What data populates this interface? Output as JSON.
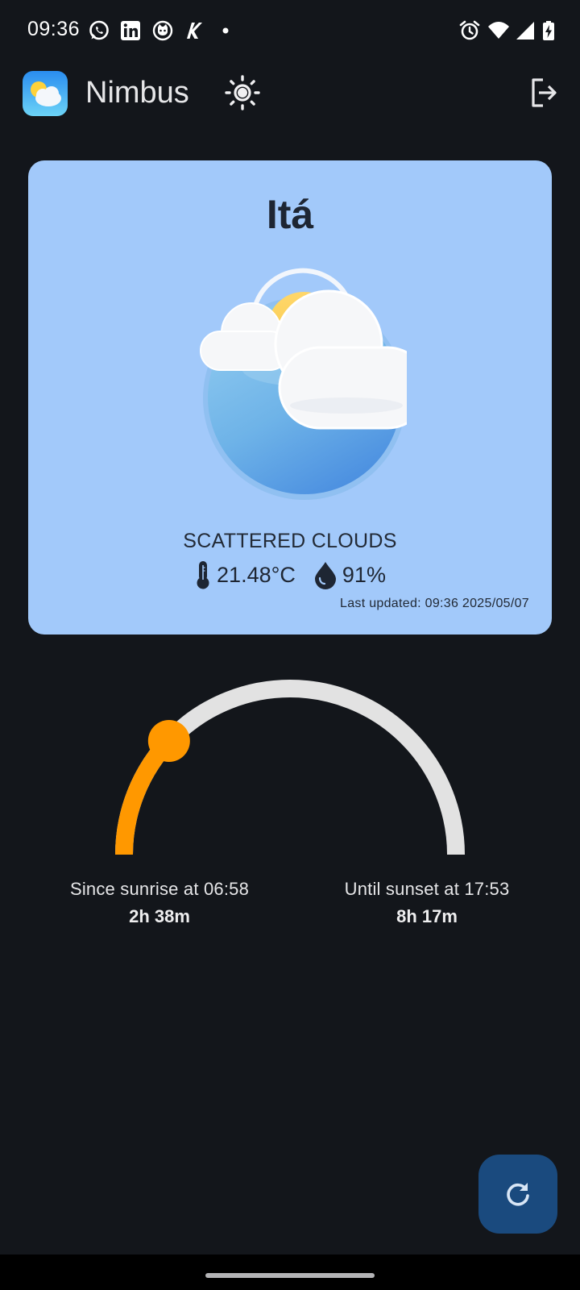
{
  "status_bar": {
    "time": "09:36",
    "notification_icons": [
      "whatsapp-icon",
      "linkedin-icon",
      "github-icon",
      "kiwi-icon",
      "dot-icon"
    ],
    "system_icons": [
      "alarm-icon",
      "wifi-icon",
      "signal-icon",
      "battery-charging-icon"
    ]
  },
  "app_bar": {
    "title": "Nimbus",
    "theme_icon": "sun-icon",
    "logout_icon": "logout-icon"
  },
  "weather": {
    "city": "Itá",
    "condition": "SCATTERED CLOUDS",
    "temperature": "21.48°C",
    "humidity": "91%",
    "last_updated": "Last updated: 09:36 2025/05/07",
    "illustration": "sun-behind-clouds-icon"
  },
  "sun_cycle": {
    "progress": 0.24,
    "sunrise_label": "Since sunrise at 06:58",
    "since_sunrise": "2h 38m",
    "sunset_label": "Until sunset at 17:53",
    "until_sunset": "8h 17m",
    "colors": {
      "elapsed": "#ff9800",
      "remaining": "#e2e2e2"
    }
  },
  "fab": {
    "icon": "refresh-icon"
  },
  "colors": {
    "background": "#13161b",
    "card": "#a2c9fa",
    "fab": "#1a4a7e"
  }
}
